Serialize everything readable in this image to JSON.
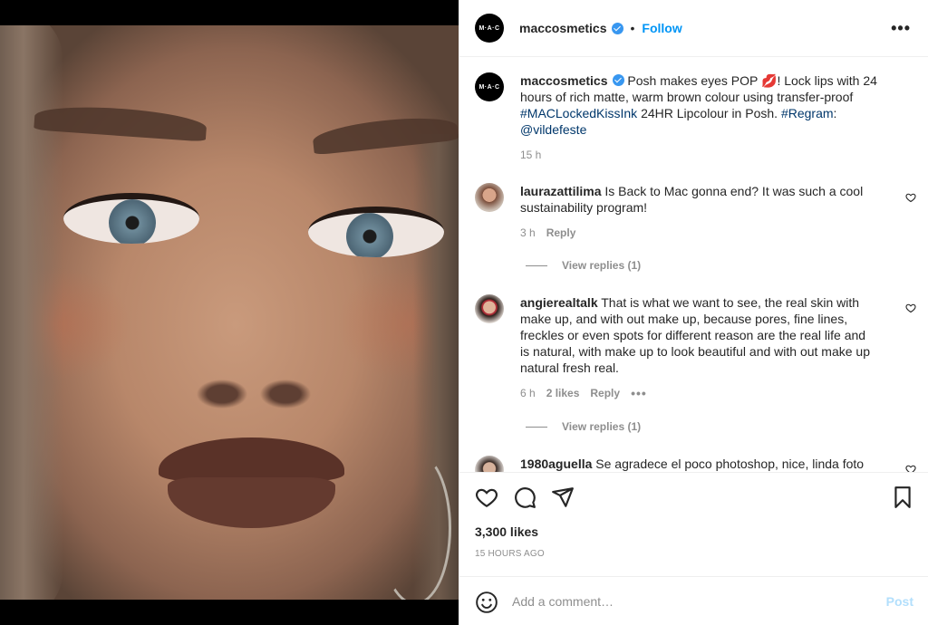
{
  "post": {
    "username": "maccosmetics",
    "avatar_text": "M·A·C",
    "verified": true,
    "separator": "•",
    "follow_label": "Follow",
    "more_label": "•••"
  },
  "caption": {
    "username": "maccosmetics",
    "text_1": "Posh makes eyes POP",
    "emoji": "💋",
    "text_2": "! Lock lips with 24 hours of rich matte, warm brown colour using transfer-proof",
    "hashtag_1": "#MACLockedKissInk",
    "text_3": "24HR Lipcolour in Posh.",
    "hashtag_2": "#Regram",
    "text_4": ":",
    "mention": "@vildefeste",
    "time": "15 h"
  },
  "comments": [
    {
      "username": "laurazattilima",
      "text": "Is Back to Mac gonna end? It was such a cool sustainability program!",
      "time": "3 h",
      "likes": "",
      "reply_label": "Reply",
      "view_replies": "View replies (1)"
    },
    {
      "username": "angierealtalk",
      "text": "That is what we want to see, the real skin with make up, and with out make up, because pores, fine lines, freckles or even spots for different reason are the real life and is natural, with make up to look beautiful and with out make up natural fresh real.",
      "time": "6 h",
      "likes": "2 likes",
      "reply_label": "Reply",
      "more_label": "•••",
      "view_replies": "View replies (1)"
    },
    {
      "username": "1980aguella",
      "text": "Se agradece el poco photoshop, nice, linda foto"
    }
  ],
  "actions": {
    "likes": "3,300 likes",
    "time_ago": "15 HOURS AGO",
    "icons": [
      "heart-icon",
      "comment-icon",
      "share-icon",
      "bookmark-icon"
    ]
  },
  "add_comment": {
    "placeholder": "Add a comment…",
    "post_label": "Post"
  },
  "colors": {
    "link_blue": "#0095f6",
    "hashtag": "#00376b",
    "muted": "#8e8e8e",
    "post_disabled": "#b2dffc"
  }
}
